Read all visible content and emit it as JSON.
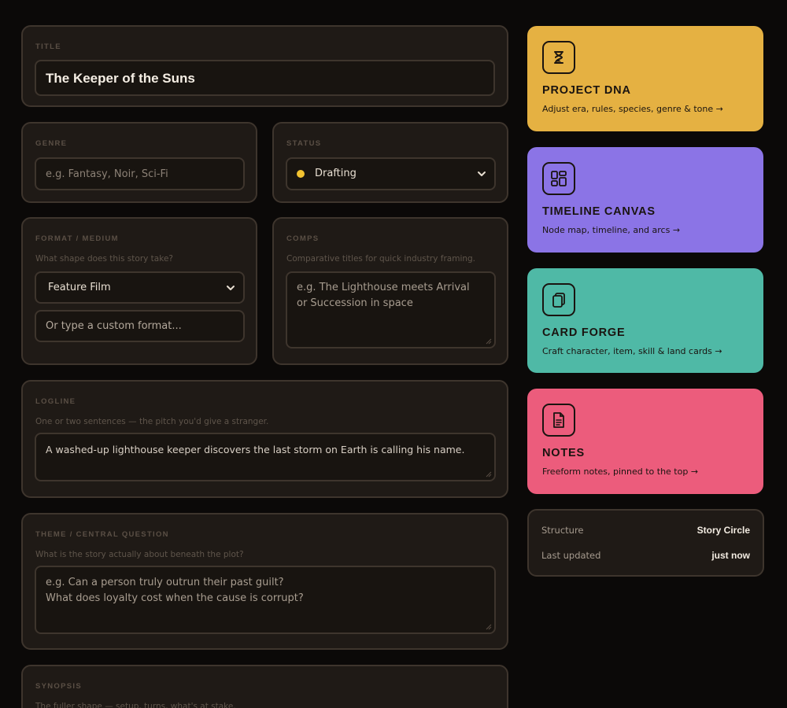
{
  "title_panel": {
    "label": "TITLE",
    "value": "The Keeper of the Suns"
  },
  "genre_panel": {
    "label": "GENRE",
    "placeholder": "e.g. Fantasy, Noir, Sci-Fi"
  },
  "status_panel": {
    "label": "STATUS",
    "value": "Drafting",
    "dot_color": "#f2c230"
  },
  "format_panel": {
    "label": "FORMAT / MEDIUM",
    "hint": "What shape does this story take?",
    "selected": "Feature Film",
    "custom_placeholder": "Or type a custom format..."
  },
  "comps_panel": {
    "label": "COMPS",
    "hint": "Comparative titles for quick industry framing.",
    "placeholder_line1": "e.g. The Lighthouse meets Arrival",
    "placeholder_line2": "or Succession in space"
  },
  "logline_panel": {
    "label": "LOGLINE",
    "hint": "One or two sentences — the pitch you'd give a stranger.",
    "value": "A washed-up lighthouse keeper discovers the last storm on Earth is calling his name."
  },
  "theme_panel": {
    "label": "THEME / CENTRAL QUESTION",
    "hint": "What is the story actually about beneath the plot?",
    "placeholder_line1": "e.g. Can a person truly outrun their past guilt?",
    "placeholder_line2": "What does loyalty cost when the cause is corrupt?"
  },
  "synopsis_panel": {
    "label": "SYNOPSIS",
    "hint": "The fuller shape — setup, turns, what's at stake."
  },
  "cards": [
    {
      "title": "PROJECT DNA",
      "subtitle": "Adjust era, rules, species, genre & tone →",
      "icon": "hourglass-icon",
      "color": "#e5b142"
    },
    {
      "title": "TIMELINE CANVAS",
      "subtitle": "Node map, timeline, and arcs →",
      "icon": "layout-grid-icon",
      "color": "#8b74e6"
    },
    {
      "title": "CARD FORGE",
      "subtitle": "Craft character, item, skill & land cards →",
      "icon": "cards-stack-icon",
      "color": "#4fb9a6"
    },
    {
      "title": "NOTES",
      "subtitle": "Freeform notes, pinned to the top →",
      "icon": "document-icon",
      "color": "#ec5c7c"
    }
  ],
  "meta": {
    "structure_label": "Structure",
    "structure_value": "Story Circle",
    "updated_label": "Last updated",
    "updated_value": "just now"
  }
}
